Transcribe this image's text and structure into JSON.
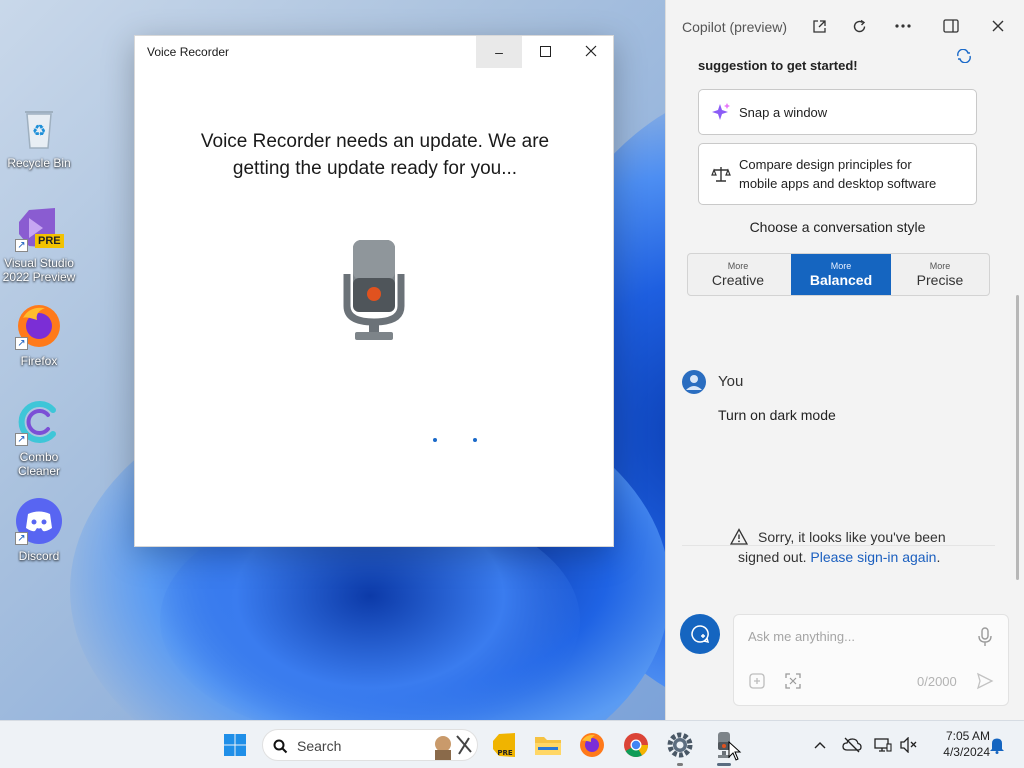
{
  "desktop": {
    "icons": [
      {
        "label": "Recycle Bin",
        "icon": "recycle-bin-icon"
      },
      {
        "label": "Visual Studio 2022 Preview",
        "line1": "Visual Studio",
        "line2": "2022 Preview",
        "icon": "visual-studio-icon",
        "badge": "PRE"
      },
      {
        "label": "Firefox",
        "icon": "firefox-icon"
      },
      {
        "label": "Combo Cleaner",
        "line1": "Combo",
        "line2": "Cleaner",
        "icon": "combo-cleaner-icon"
      },
      {
        "label": "Discord",
        "icon": "discord-icon"
      }
    ]
  },
  "voice_recorder": {
    "title": "Voice Recorder",
    "message": "Voice Recorder needs an update. We are getting the update ready for you...",
    "minimize": "–",
    "maximize": "☐",
    "close": "✕"
  },
  "copilot": {
    "title": "Copilot (preview)",
    "intro": "suggestion to get started!",
    "suggestions": [
      {
        "text": "Snap a window",
        "icon": "sparkle-icon"
      },
      {
        "line1": "Compare design principles for",
        "line2": "mobile apps and desktop software",
        "icon": "scales-icon"
      }
    ],
    "style_label": "Choose a conversation style",
    "styles": [
      {
        "small": "More",
        "big": "Creative",
        "active": false
      },
      {
        "small": "More",
        "big": "Balanced",
        "active": true
      },
      {
        "small": "More",
        "big": "Precise",
        "active": false
      }
    ],
    "user": {
      "name": "You",
      "message": "Turn on dark mode"
    },
    "signout": {
      "line1": "Sorry, it looks like you've been",
      "line2_prefix": "signed out.",
      "link": "Please sign-in again",
      "suffix": "."
    },
    "input": {
      "placeholder": "Ask me anything...",
      "counter": "0/2000"
    },
    "accent": "#1565c0"
  },
  "taskbar": {
    "search_placeholder": "Search",
    "pinned": [
      "start-icon",
      "visual-studio-icon",
      "file-explorer-icon",
      "firefox-icon",
      "chrome-icon",
      "settings-icon",
      "voice-recorder-icon"
    ],
    "clock": {
      "time": "7:05 AM",
      "date": "4/3/2024"
    }
  }
}
